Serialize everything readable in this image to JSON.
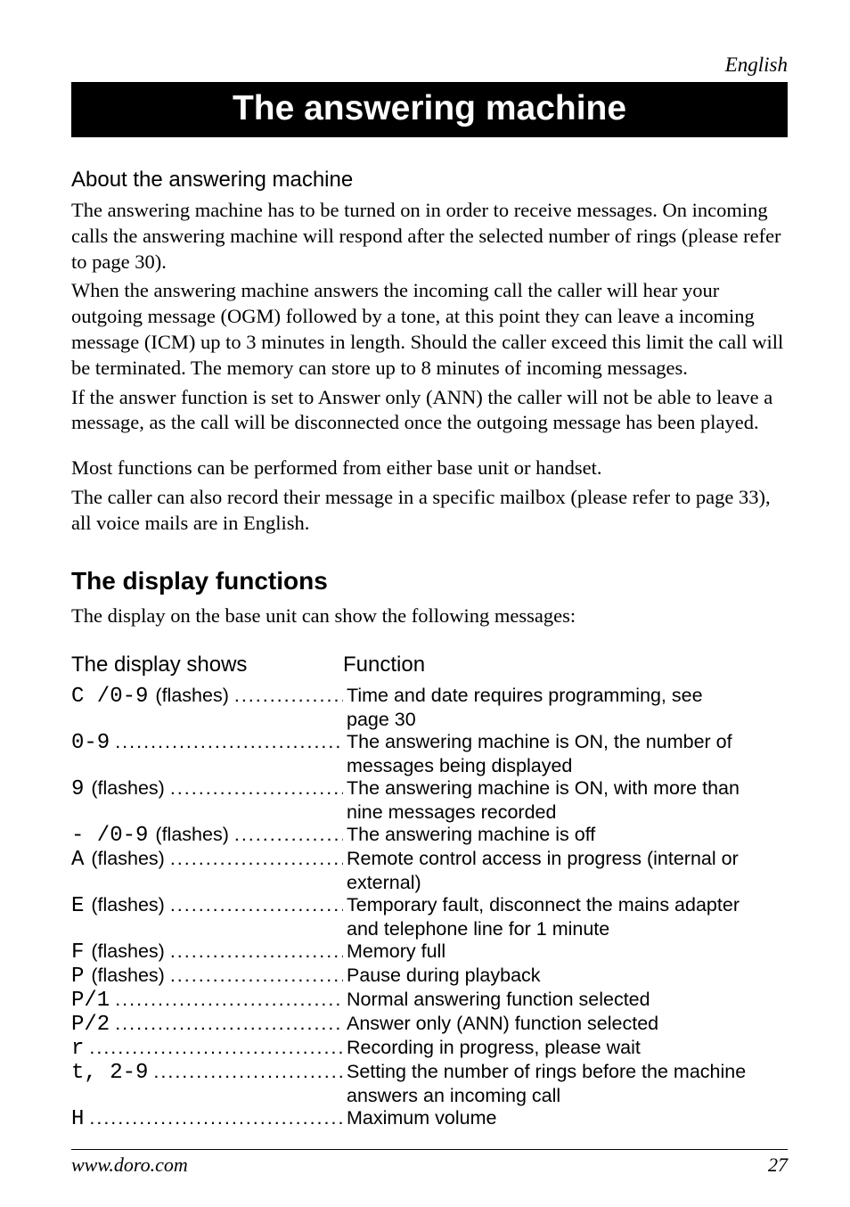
{
  "header": {
    "language": "English",
    "title": "The answering machine"
  },
  "about": {
    "heading": "About the answering machine",
    "p1": "The answering machine has to be turned on in order to receive messages. On incoming calls the answering machine will respond after the selected number of rings (please refer to page 30).",
    "p2": "When the answering machine answers the incoming call the caller will hear your outgoing message (OGM) followed by a tone, at this point they can leave a incoming message (ICM) up to 3 minutes in length. Should the caller exceed this limit the call will be terminated. The memory can store up to 8 minutes of incoming messages.",
    "p3": "If the answer function is set to Answer only (ANN) the caller will not be able to leave a message, as the call will be disconnected once the outgoing message has been played.",
    "p4": "Most functions can be performed from either base unit or handset.",
    "p5": "The caller can also record their message in a specific mailbox (please refer to page 33), all voice mails are in English."
  },
  "display_section": {
    "heading": "The display functions",
    "intro": "The display on the base unit can show the following messages:",
    "col1": "The display shows",
    "col2": "Function",
    "rows": [
      {
        "glyph": "C /0-9",
        "paren": "(flashes)",
        "func": "Time and date requires programming, see",
        "cont": "page 30"
      },
      {
        "glyph": "0-9",
        "paren": "",
        "func": "The answering machine is ON, the number of",
        "cont": "messages being displayed"
      },
      {
        "glyph": "9",
        "paren": "(flashes)",
        "func": "The answering machine is ON, with more than",
        "cont": "nine messages recorded"
      },
      {
        "glyph": "- /0-9 ",
        "paren": " (flashes)",
        "func": "The answering machine is off",
        "cont": ""
      },
      {
        "glyph": "A",
        "paren": "(flashes)",
        "func": "Remote control access in progress (internal or",
        "cont": "external)"
      },
      {
        "glyph": "E",
        "paren": "(flashes)",
        "func": "Temporary fault, disconnect the mains adapter",
        "cont": "and telephone line for 1 minute"
      },
      {
        "glyph": "F",
        "paren": "(flashes)",
        "func": "Memory full",
        "cont": ""
      },
      {
        "glyph": "P",
        "paren": "(flashes)",
        "func": "Pause during playback",
        "cont": ""
      },
      {
        "glyph": "P/1",
        "paren": "",
        "func": "Normal answering function selected",
        "cont": ""
      },
      {
        "glyph": "P/2",
        "paren": "",
        "func": "Answer only (ANN) function selected",
        "cont": ""
      },
      {
        "glyph": "r",
        "paren": "",
        "func": "Recording in progress, please wait",
        "cont": ""
      },
      {
        "glyph": "t, 2-9",
        "paren": "",
        "func": "Setting the number of rings before the machine",
        "cont": "answers an incoming call"
      },
      {
        "glyph": "H",
        "paren": "",
        "func": "Maximum volume",
        "cont": ""
      }
    ]
  },
  "footer": {
    "url": "www.doro.com",
    "page": "27"
  }
}
